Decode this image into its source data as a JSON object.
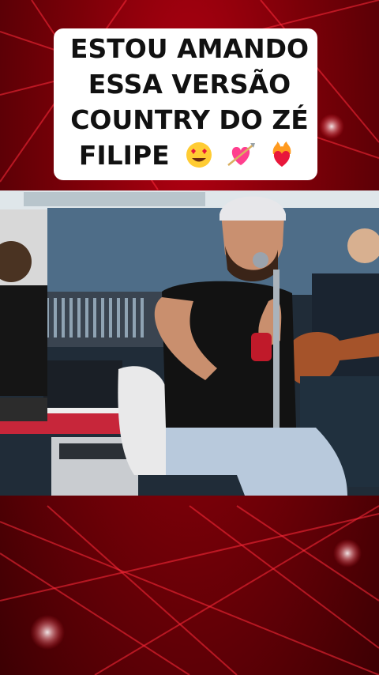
{
  "caption": {
    "line1": "ESTOU AMANDO",
    "line2": "ESSA VERSÃO",
    "line3": "COUNTRY DO ZÉ",
    "line4": "FILIPE"
  },
  "emojis": [
    "heart-eyes-face-icon",
    "heart-with-arrow-icon",
    "heart-on-fire-icon"
  ],
  "colors": {
    "background": "#8b000d",
    "laser": "#ff2a3a",
    "caption_box": "#ffffff",
    "caption_text": "#111111"
  }
}
